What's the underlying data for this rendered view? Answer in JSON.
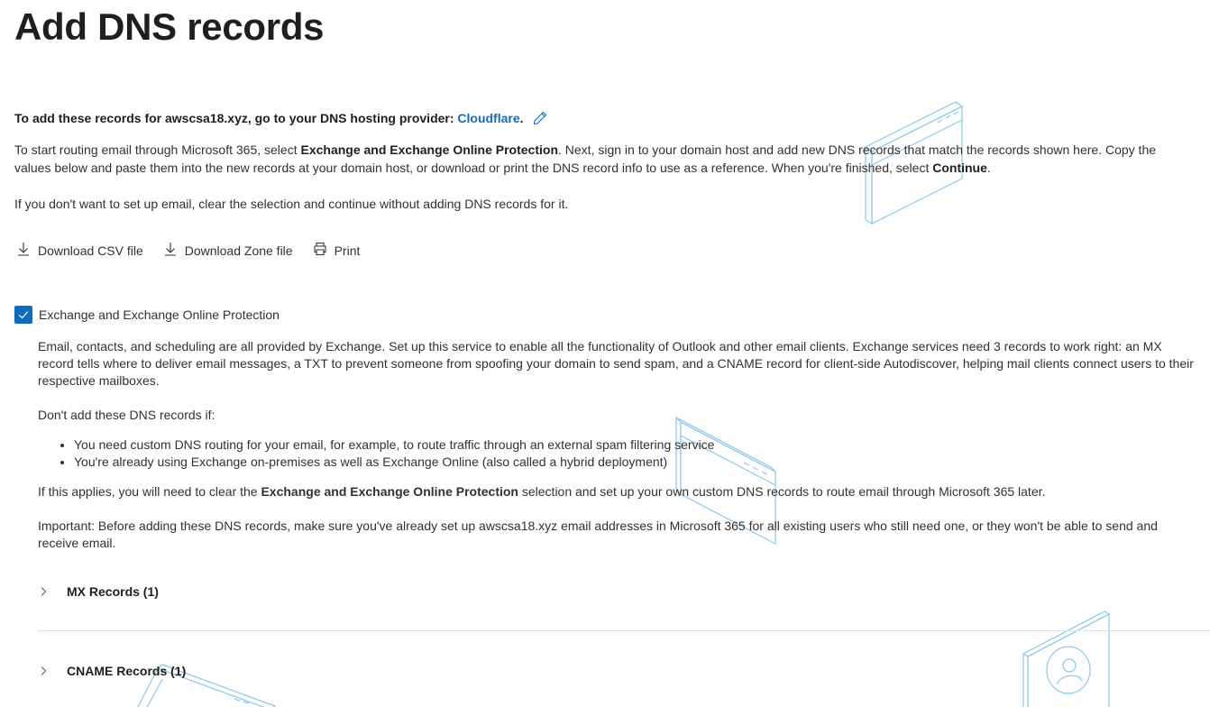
{
  "page_title": "Add DNS records",
  "provider_line": {
    "prefix": "To add these records for awscsa18.xyz, go to your DNS hosting provider: ",
    "provider_link": "Cloudflare",
    "suffix": "."
  },
  "intro": {
    "part1": "To start routing email through Microsoft 365, select ",
    "bold1": "Exchange and Exchange Online Protection",
    "part2": ". Next, sign in to your domain host and add new DNS records that match the records shown here. Copy the values below and paste them into the new records at your domain host, or download or print the DNS record info to use as a reference. When you're finished, select ",
    "bold2": "Continue",
    "part3": "."
  },
  "no_email_note": "If you don't want to set up email, clear the selection and continue without adding DNS records for it.",
  "actions": {
    "download_csv": "Download CSV file",
    "download_zone": "Download Zone file",
    "print": "Print"
  },
  "exchange_checkbox": {
    "label": "Exchange and Exchange Online Protection",
    "checked": true
  },
  "exchange_description": "Email, contacts, and scheduling are all provided by Exchange. Set up this service to enable all the functionality of Outlook and other email clients. Exchange services need 3 records to work right: an MX record tells where to deliver email messages, a TXT to prevent someone from spoofing your domain to send spam, and a CNAME record for client-side Autodiscover, helping mail clients connect users to their respective mailboxes.",
  "dont_add_heading": "Don't add these DNS records if:",
  "dont_add_items": [
    "You need custom DNS routing for your email, for example, to route traffic through an external spam filtering service",
    "You're already using Exchange on-premises as well as Exchange Online (also called a hybrid deployment)"
  ],
  "applies_note": {
    "part1": "If this applies, you will need to clear the ",
    "bold": "Exchange and Exchange Online Protection",
    "part2": " selection and set up your own custom DNS records to route email through Microsoft 365 later."
  },
  "important_note": "Important: Before adding these DNS records, make sure you've already set up awscsa18.xyz email addresses in Microsoft 365 for all existing users who still need one, or they won't be able to send and receive email.",
  "accordions": {
    "mx": "MX Records (1)",
    "cname": "CNAME Records (1)"
  },
  "colors": {
    "accent": "#0f6cbd",
    "text": "#323130",
    "decor_line": "#8cc8ec"
  },
  "icons": [
    "pencil-icon",
    "download-icon",
    "print-icon",
    "checkmark-icon",
    "chevron-right-icon"
  ]
}
